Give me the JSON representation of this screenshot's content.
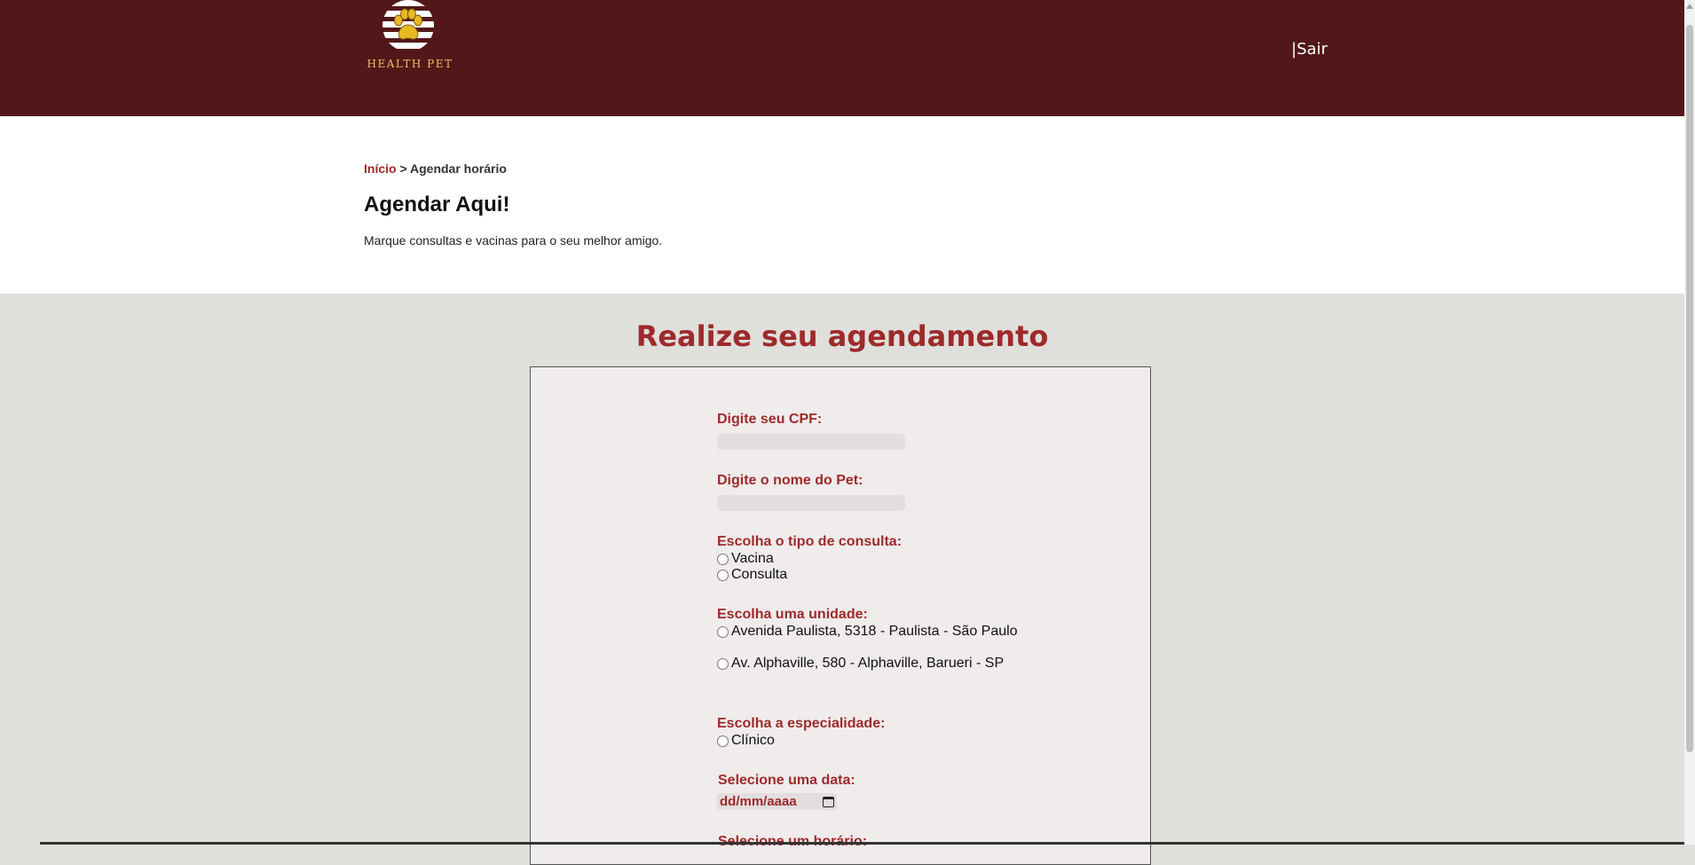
{
  "header": {
    "logo_text": "HEALTH PET",
    "logout_link": "|Sair"
  },
  "breadcrumb": {
    "home": "Início",
    "separator": " > ",
    "current": "Agendar horário"
  },
  "page": {
    "title": "Agendar Aqui!",
    "subtitle": "Marque consultas e vacinas para o seu melhor amigo."
  },
  "form": {
    "title": "Realize seu agendamento",
    "cpf_label": "Digite seu CPF:",
    "cpf_value": "",
    "pet_label": "Digite o nome do Pet:",
    "pet_value": "",
    "tipo_label": "Escolha o tipo de consulta:",
    "tipo_options": [
      "Vacina",
      "Consulta"
    ],
    "unidade_label": "Escolha uma unidade:",
    "unidade_options": [
      "Avenida Paulista, 5318 - Paulista - São Paulo",
      "Av. Alphaville, 580 - Alphaville, Barueri - SP"
    ],
    "especialidade_label": "Escolha a especialidade:",
    "especialidade_options": [
      "Clínico"
    ],
    "data_label": "Selecione uma data:",
    "data_placeholder": "dd/mm/aaaa",
    "horario_label": "Selecione um horário:"
  },
  "colors": {
    "header_bg": "#521819",
    "accent": "#9e2a2b",
    "logo_gold": "#e8c16a",
    "form_bg": "#f0ecec",
    "page_bg": "#dfdfdb"
  },
  "icons": [
    "paw-icon",
    "calendar-icon"
  ]
}
